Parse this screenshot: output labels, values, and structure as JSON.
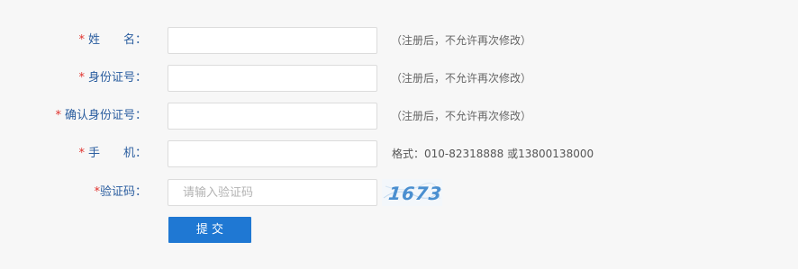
{
  "form": {
    "name": {
      "required_mark": "*",
      "label": "姓　　名：",
      "value": "",
      "hint": "（注册后，不允许再次修改）"
    },
    "id_number": {
      "required_mark": "*",
      "label": "身份证号：",
      "value": "",
      "hint": "（注册后，不允许再次修改）"
    },
    "id_confirm": {
      "required_mark": "*",
      "label": "确认身份证号：",
      "value": "",
      "hint": "（注册后，不允许再次修改）"
    },
    "phone": {
      "required_mark": "*",
      "label": "手　　机：",
      "value": "",
      "hint": "格式：010-82318888 或13800138000"
    },
    "captcha": {
      "required_mark": "*",
      "label": "验证码：",
      "value": "",
      "placeholder": "请输入验证码",
      "code": "1673"
    },
    "submit_label": "提 交"
  },
  "colors": {
    "background": "#f7f7f7",
    "label": "#2a5d9f",
    "required": "#e0322d",
    "hint": "#666666",
    "button": "#1f78d3",
    "button_text": "#ffffff",
    "captcha_text": "#4a8fd0"
  }
}
